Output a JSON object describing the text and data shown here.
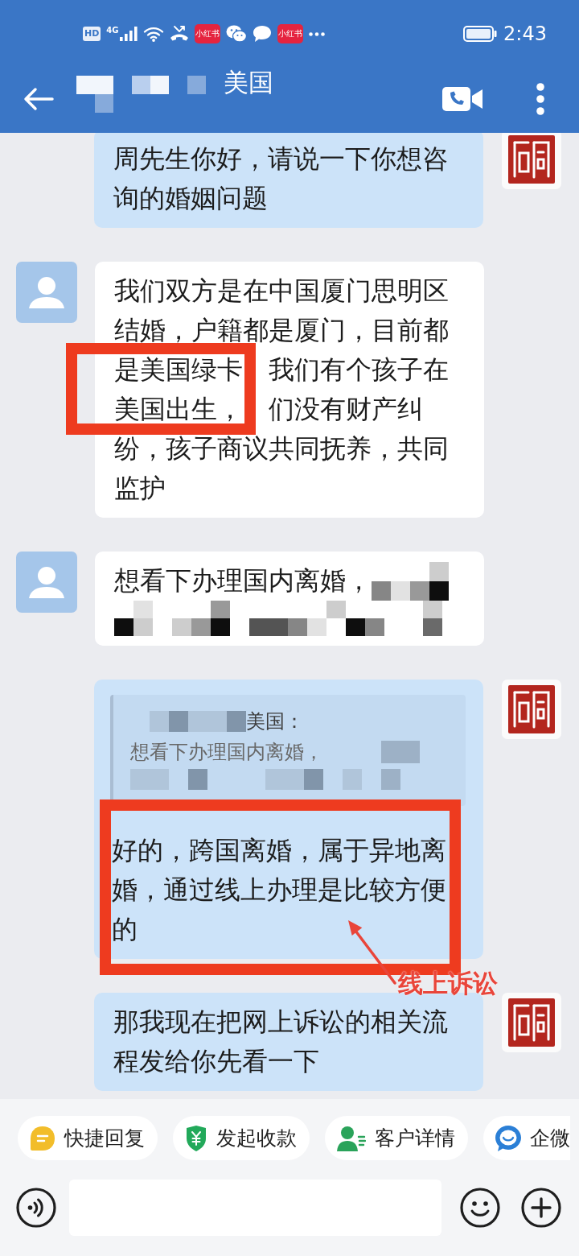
{
  "status_bar": {
    "hd_badge": "HD",
    "network": "4G",
    "app_badges": [
      "小红书",
      "小红书"
    ],
    "time": "2:43"
  },
  "header": {
    "title": "美国",
    "redacted": true
  },
  "messages": [
    {
      "kind": "outgoing",
      "text": "周先生你好，请说一下你想咨询的婚姻问题"
    },
    {
      "kind": "incoming",
      "text": "我们双方是在中国厦门思明区结婚，户籍都是厦门，目前都是美国绿卡　我们有个孩子在美国出生，　们没有财产纠纷，孩子商议共同抚养，共同监护",
      "annotation": {
        "kind": "partial"
      }
    },
    {
      "kind": "incoming",
      "text": "想看下办理国内离婚，",
      "redacted": true
    },
    {
      "kind": "outgoing",
      "quote": {
        "author": "美国：",
        "text": "想看下办理国内离婚，",
        "redacted": true
      },
      "text": "好的，跨国离婚，属于异地离婚，通过线上办理是比较方便的",
      "annotation": {
        "kind": "full",
        "label": "线上诉讼"
      }
    },
    {
      "kind": "outgoing",
      "text": "那我现在把网上诉讼的相关流程发给你先看一下"
    }
  ],
  "quick_actions": [
    {
      "kind": "reply",
      "label": "快捷回复"
    },
    {
      "kind": "payment",
      "label": "发起收款"
    },
    {
      "kind": "customer",
      "label": "客户详情"
    },
    {
      "kind": "wecom",
      "label": "企微"
    }
  ]
}
